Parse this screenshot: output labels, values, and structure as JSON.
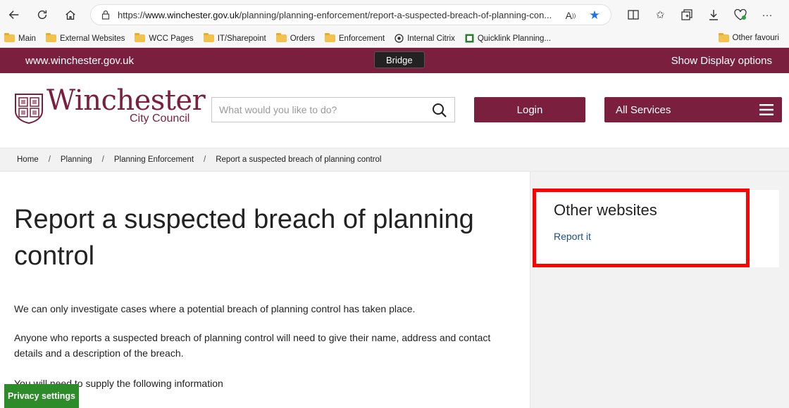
{
  "browser": {
    "url_prefix": "https://",
    "url_domain": "www.winchester.gov.uk",
    "url_path": "/planning/planning-enforcement/report-a-suspected-breach-of-planning-con...",
    "bookmarks": [
      "Main",
      "External Websites",
      "WCC Pages",
      "IT/Sharepoint",
      "Orders",
      "Enforcement",
      "Internal Citrix",
      "Quicklink Planning..."
    ],
    "other_bookmarks": "Other favouri"
  },
  "site": {
    "domain": "www.winchester.gov.uk",
    "tooltip": "Bridge",
    "display_options": "Show Display options",
    "logo_word": "Winchester",
    "logo_sub": "City Council",
    "search_placeholder": "What would you like to do?",
    "login_label": "Login",
    "services_label": "All Services"
  },
  "breadcrumb": {
    "items": [
      "Home",
      "Planning",
      "Planning Enforcement",
      "Report a suspected breach of planning control"
    ]
  },
  "main": {
    "title": "Report a suspected breach of planning control",
    "paragraphs": [
      "We can only investigate cases where a potential breach of planning control has taken place.",
      "Anyone who reports a suspected breach of planning control will need to give their name, address and contact details and a description of the breach.",
      "You will need to supply the following information"
    ]
  },
  "sidebar": {
    "heading": "Other websites",
    "link": "Report it"
  },
  "privacy": {
    "label": "Privacy settings"
  },
  "colors": {
    "brand": "#7a1f3d",
    "highlight": "#ff0000",
    "privacy_green": "#2e8b2a",
    "link": "#1a4f86"
  }
}
